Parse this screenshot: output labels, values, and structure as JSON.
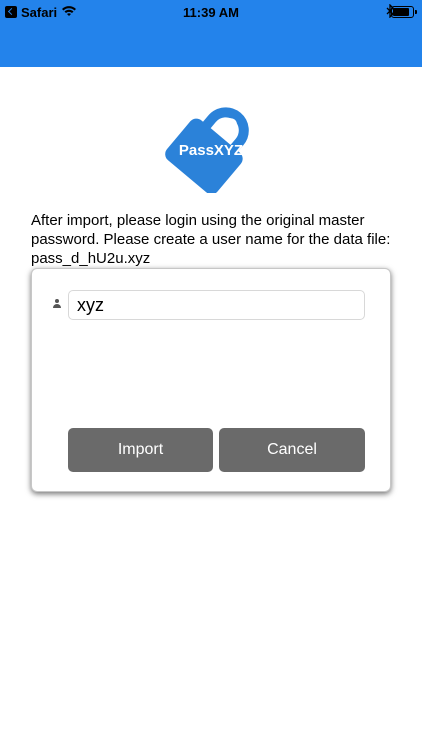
{
  "status_bar": {
    "back_app_label": "Safari",
    "time": "11:39 AM",
    "battery_level": 0.92
  },
  "logo": {
    "text": "PassXYZ",
    "color": "#2b82d9"
  },
  "message": "After import, please login using the original master password. Please create a user name for the data file: pass_d_hU2u.xyz",
  "dialog": {
    "user_name_value": "xyz",
    "import_label": "Import",
    "cancel_label": "Cancel"
  },
  "colors": {
    "header": "#2383eb",
    "button": "#6a6a6a"
  }
}
